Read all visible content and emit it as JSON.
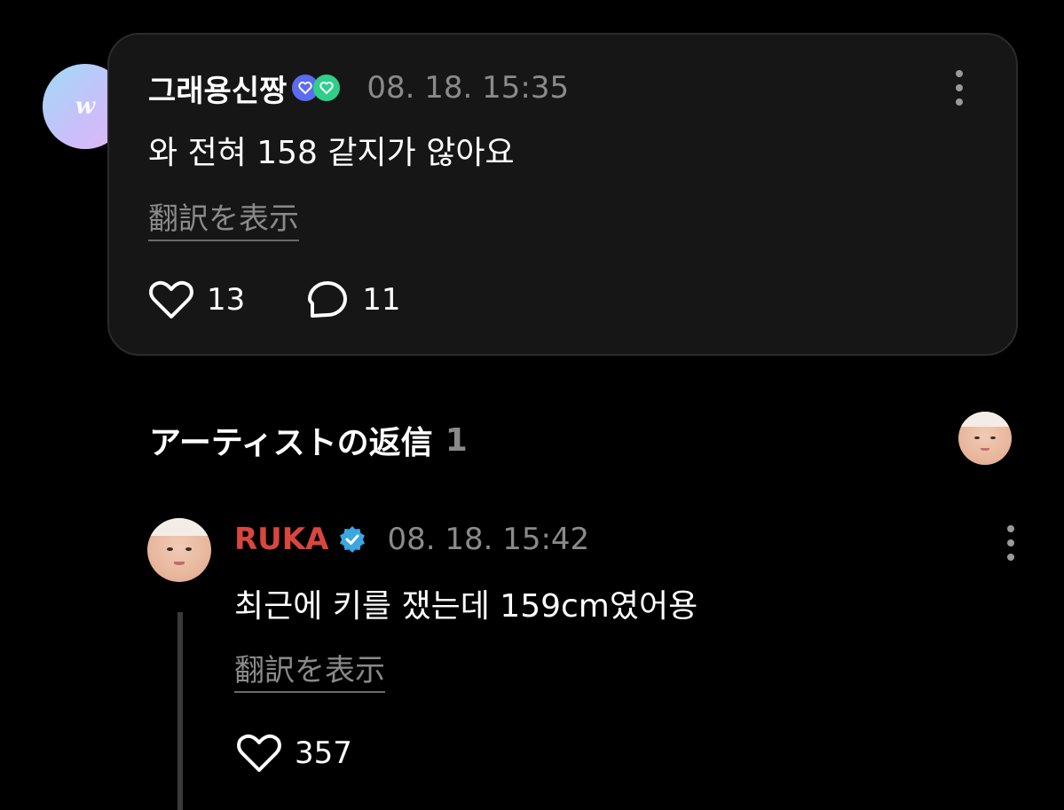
{
  "comment": {
    "avatar_letter": "w",
    "author": "그래용신짱",
    "timestamp": "08. 18. 15:35",
    "text": "와 전혀 158 같지가 않아요",
    "translate_label": "翻訳を表示",
    "likes": "13",
    "replies": "11"
  },
  "artist_replies": {
    "title": "アーティストの返信",
    "count": "1"
  },
  "reply": {
    "author": "RUKA",
    "timestamp": "08. 18. 15:42",
    "text": "최근에 키를 쟀는데 159cm였어용",
    "translate_label": "翻訳を表示",
    "likes": "357"
  },
  "colors": {
    "background": "#000000",
    "card": "#161616",
    "artist_name": "#d9463e",
    "verified": "#3aa7e0",
    "muted_text": "#8a8a8a"
  }
}
